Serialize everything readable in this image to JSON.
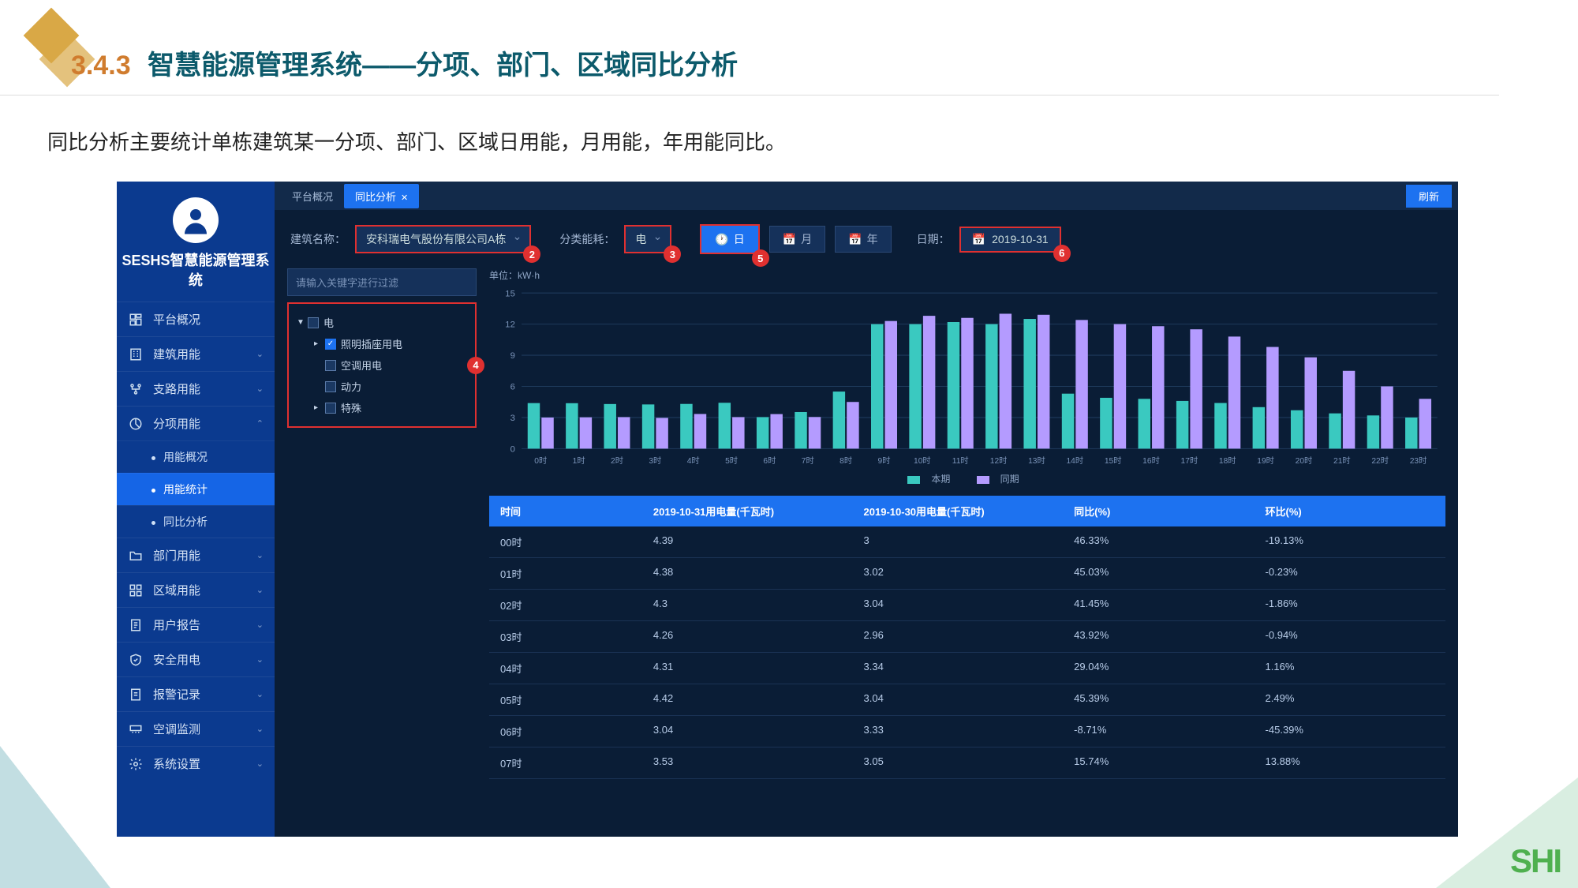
{
  "slide": {
    "number": "3.4.3",
    "title": "智慧能源管理系统——分项、部门、区域同比分析",
    "description": "同比分析主要统计单栋建筑某一分项、部门、区域日用能，月用能，年用能同比。"
  },
  "sidebar": {
    "system_name": "SESHS智慧能源管理系统",
    "items": [
      {
        "icon": "dashboard",
        "label": "平台概况",
        "expandable": false
      },
      {
        "icon": "building",
        "label": "建筑用能",
        "expandable": true
      },
      {
        "icon": "branch",
        "label": "支路用能",
        "expandable": true
      },
      {
        "icon": "category",
        "label": "分项用能",
        "expandable": true,
        "expanded": true,
        "children": [
          {
            "label": "用能概况",
            "active": false
          },
          {
            "label": "用能统计",
            "active": true
          },
          {
            "label": "同比分析",
            "active": false
          }
        ]
      },
      {
        "icon": "folder",
        "label": "部门用能",
        "expandable": true
      },
      {
        "icon": "grid",
        "label": "区域用能",
        "expandable": true
      },
      {
        "icon": "report",
        "label": "用户报告",
        "expandable": true
      },
      {
        "icon": "shield",
        "label": "安全用电",
        "expandable": true
      },
      {
        "icon": "alert",
        "label": "报警记录",
        "expandable": true
      },
      {
        "icon": "ac",
        "label": "空调监测",
        "expandable": true
      },
      {
        "icon": "gear",
        "label": "系统设置",
        "expandable": true
      }
    ]
  },
  "tabs": [
    {
      "label": "平台概况",
      "active": false
    },
    {
      "label": "同比分析",
      "active": true,
      "closable": true
    }
  ],
  "refresh_label": "刷新",
  "filters": {
    "building_label": "建筑名称：",
    "building_value": "安科瑞电气股份有限公司A栋",
    "energy_label": "分类能耗：",
    "energy_value": "电",
    "period_day": "日",
    "period_month": "月",
    "period_year": "年",
    "date_label": "日期：",
    "date_value": "2019-10-31"
  },
  "badges": {
    "b2": "2",
    "b3": "3",
    "b4": "4",
    "b5": "5",
    "b6": "6"
  },
  "tree": {
    "search_placeholder": "请输入关键字进行过滤",
    "root": "电",
    "nodes": [
      {
        "label": "照明插座用电",
        "checked": true
      },
      {
        "label": "空调用电",
        "checked": false
      },
      {
        "label": "动力",
        "checked": false
      },
      {
        "label": "特殊",
        "checked": false
      }
    ]
  },
  "chart_data": {
    "type": "bar",
    "unit": "单位：kW·h",
    "legend": {
      "current": "本期",
      "previous": "同期"
    },
    "categories": [
      "0时",
      "1时",
      "2时",
      "3时",
      "4时",
      "5时",
      "6时",
      "7时",
      "8时",
      "9时",
      "10时",
      "11时",
      "12时",
      "13时",
      "14时",
      "15时",
      "16时",
      "17时",
      "18时",
      "19时",
      "20时",
      "21时",
      "22时",
      "23时"
    ],
    "series": [
      {
        "name": "本期",
        "color": "#3ac9c0",
        "values": [
          4.39,
          4.38,
          4.3,
          4.26,
          4.31,
          4.42,
          3.04,
          3.53,
          5.5,
          12.0,
          12.0,
          12.2,
          12.0,
          12.5,
          5.3,
          4.9,
          4.8,
          4.6,
          4.4,
          4.0,
          3.7,
          3.4,
          3.2,
          3.0
        ]
      },
      {
        "name": "同期",
        "color": "#b49bff",
        "values": [
          3.0,
          3.02,
          3.04,
          2.96,
          3.34,
          3.04,
          3.33,
          3.05,
          4.5,
          12.3,
          12.8,
          12.6,
          13.0,
          12.9,
          12.4,
          12.0,
          11.8,
          11.5,
          10.8,
          9.8,
          8.8,
          7.5,
          6.0,
          4.8
        ]
      }
    ],
    "ylim": [
      0,
      15
    ],
    "yticks": [
      0,
      3,
      6,
      9,
      12,
      15
    ]
  },
  "table": {
    "headers": [
      "时间",
      "2019-10-31用电量(千瓦时)",
      "2019-10-30用电量(千瓦时)",
      "同比(%)",
      "环比(%)"
    ],
    "rows": [
      [
        "00时",
        "4.39",
        "3",
        "46.33%",
        "-19.13%"
      ],
      [
        "01时",
        "4.38",
        "3.02",
        "45.03%",
        "-0.23%"
      ],
      [
        "02时",
        "4.3",
        "3.04",
        "41.45%",
        "-1.86%"
      ],
      [
        "03时",
        "4.26",
        "2.96",
        "43.92%",
        "-0.94%"
      ],
      [
        "04时",
        "4.31",
        "3.34",
        "29.04%",
        "1.16%"
      ],
      [
        "05时",
        "4.42",
        "3.04",
        "45.39%",
        "2.49%"
      ],
      [
        "06时",
        "3.04",
        "3.33",
        "-8.71%",
        "-45.39%"
      ],
      [
        "07时",
        "3.53",
        "3.05",
        "15.74%",
        "13.88%"
      ]
    ]
  },
  "footer_logo": "SHI"
}
